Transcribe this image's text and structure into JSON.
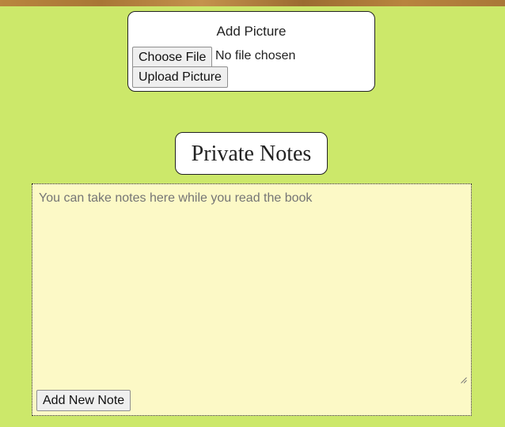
{
  "upload": {
    "title": "Add Picture",
    "choose_file_label": "Choose File",
    "no_file_text": "No file chosen",
    "upload_label": "Upload Picture"
  },
  "notes": {
    "title": "Private Notes",
    "placeholder": "You can take notes here while you read the book",
    "value": "",
    "add_note_label": "Add New Note"
  },
  "colors": {
    "page_background": "#cce86a",
    "notes_background": "#fcf9c6",
    "banner": "#b07d3a"
  }
}
